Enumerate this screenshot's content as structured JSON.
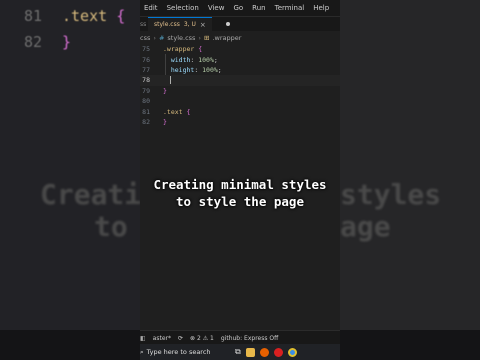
{
  "background": {
    "code_lines": [
      {
        "num": "81",
        "text": ".text {",
        "parts": [
          {
            "t": ".text ",
            "c": "#d7ba7d"
          },
          {
            "t": "{",
            "c": "#da70d6"
          }
        ]
      },
      {
        "num": "82",
        "text": "}",
        "parts": [
          {
            "t": "}",
            "c": "#da70d6"
          }
        ]
      }
    ],
    "caption_left": [
      "Creati",
      "to s"
    ],
    "caption_right": [
      "styles",
      "age"
    ]
  },
  "menu": [
    "Edit",
    "Selection",
    "View",
    "Go",
    "Run",
    "Terminal",
    "Help"
  ],
  "tab": {
    "side_label": "ss",
    "filename": "style.css",
    "status": "3, U",
    "close": "×"
  },
  "breadcrumbs": {
    "folder": "css",
    "file": "style.css",
    "symbol": ".wrapper"
  },
  "code": [
    {
      "ln": "75",
      "parts": [
        {
          "t": ".wrapper ",
          "cls": "sel"
        },
        {
          "t": "{",
          "cls": "brace"
        }
      ]
    },
    {
      "ln": "76",
      "parts": [
        {
          "t": "  width",
          "cls": "prop"
        },
        {
          "t": ": ",
          "cls": "punc"
        },
        {
          "t": "100%",
          "cls": "num"
        },
        {
          "t": ";",
          "cls": "punc"
        }
      ]
    },
    {
      "ln": "77",
      "parts": [
        {
          "t": "  height",
          "cls": "prop"
        },
        {
          "t": ": ",
          "cls": "punc"
        },
        {
          "t": "100%",
          "cls": "num"
        },
        {
          "t": ";",
          "cls": "punc"
        }
      ]
    },
    {
      "ln": "78",
      "active": true,
      "cursor": true,
      "parts": []
    },
    {
      "ln": "79",
      "parts": [
        {
          "t": "}",
          "cls": "brace"
        }
      ]
    },
    {
      "ln": "80",
      "parts": []
    },
    {
      "ln": "81",
      "parts": [
        {
          "t": ".text ",
          "cls": "sel"
        },
        {
          "t": "{",
          "cls": "brace"
        }
      ]
    },
    {
      "ln": "82",
      "parts": [
        {
          "t": "}",
          "cls": "brace"
        }
      ]
    }
  ],
  "caption": [
    "Creating minimal styles",
    "to style the page"
  ],
  "status": {
    "branch": "aster*",
    "errors": "2",
    "warnings": "1",
    "github": "github: Express Off"
  },
  "taskbar": {
    "search_placeholder": "Type here to search"
  },
  "colors": {
    "accent": "#0078d4",
    "bg": "#1f1f1f"
  }
}
